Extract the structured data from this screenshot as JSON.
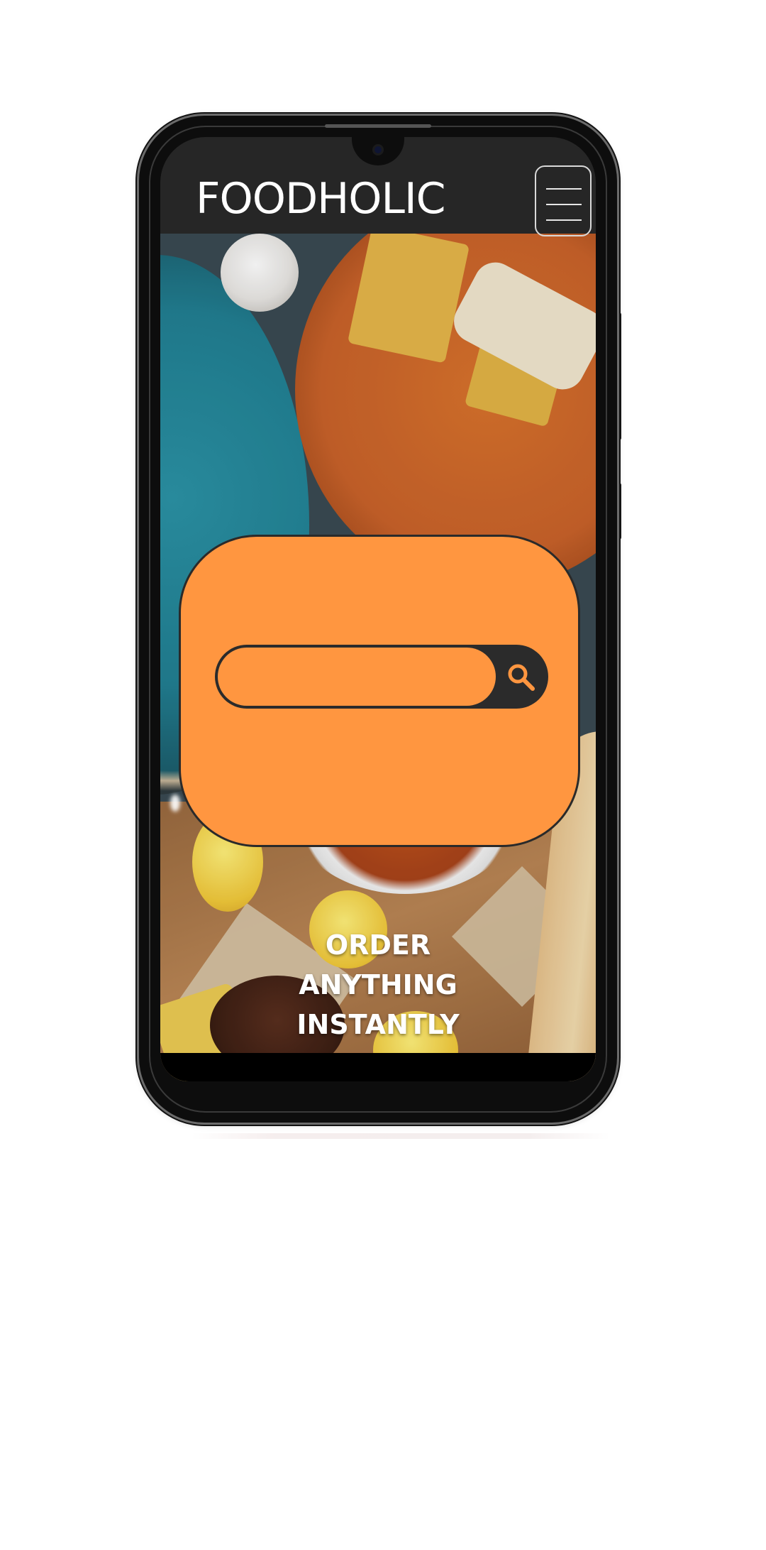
{
  "app": {
    "brand": "FOODHOLIC",
    "tagline_lines": [
      "ORDER",
      "ANYTHING",
      "INSTANTLY"
    ]
  },
  "header": {
    "menu_icon": "hamburger-menu-icon"
  },
  "search": {
    "placeholder": "",
    "value": "",
    "icon": "search-icon"
  },
  "colors": {
    "accent": "#ff9640",
    "appbar": "#262626",
    "search_track": "#2b2b2b",
    "text_light": "#ffffff"
  }
}
